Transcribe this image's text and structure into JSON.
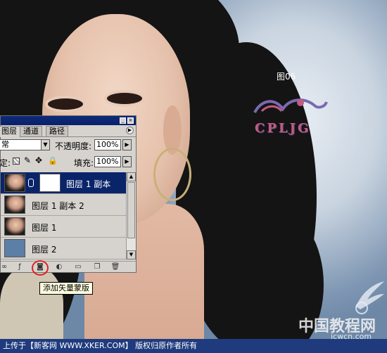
{
  "figure_label": "图06",
  "logo": {
    "text": "CPLJG"
  },
  "watermark": {
    "text": "中国教程网",
    "url": "jcwcn.com"
  },
  "footer": {
    "text": "上传于【新客网 WWW.XKER.COM】 版权归原作者所有"
  },
  "panel": {
    "tabs": [
      {
        "label": "图层"
      },
      {
        "label": "通道"
      },
      {
        "label": "路径"
      }
    ],
    "blend_mode": "常",
    "opacity_label": "不透明度:",
    "opacity_value": "100%",
    "lock_label": "定:",
    "fill_label": "填充:",
    "fill_value": "100%",
    "layers": [
      {
        "name": "图层 1 副本",
        "selected": true,
        "has_mask": true
      },
      {
        "name": "图层 1 副本 2",
        "selected": false,
        "has_mask": false
      },
      {
        "name": "图层 1",
        "selected": false,
        "has_mask": false
      },
      {
        "name": "图层 2",
        "selected": false,
        "has_mask": false,
        "thumb_color": "#5b7fa6"
      }
    ],
    "tooltip": "添加矢量蒙版"
  },
  "colors": {
    "selection": "#0a246a",
    "titlebar": "#0d2a78",
    "footer": "#1f3b7d",
    "highlight": "#e02020"
  }
}
